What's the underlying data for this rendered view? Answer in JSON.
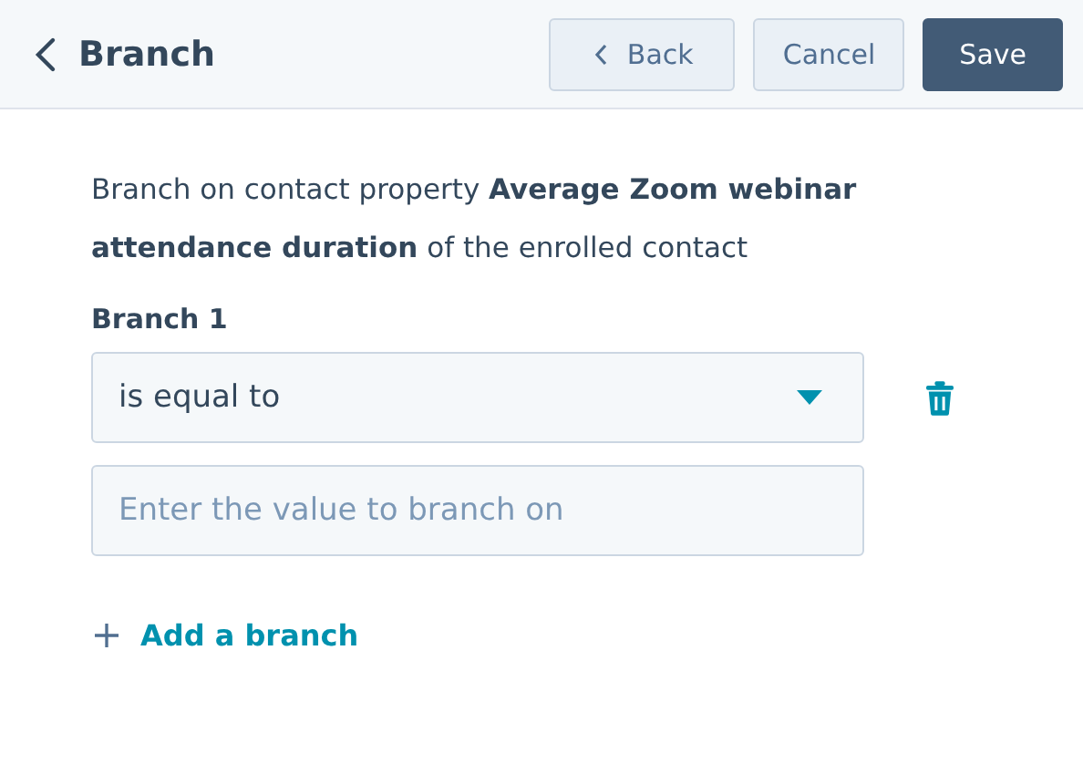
{
  "header": {
    "title": "Branch",
    "buttons": [
      {
        "label": "Back",
        "kind": "back"
      },
      {
        "label": "Cancel",
        "kind": "secondary"
      },
      {
        "label": "Save",
        "kind": "primary"
      }
    ]
  },
  "description": "Branch on contact property **Average Zoom webinar attendance duration** of the enrolled contact",
  "branches": [
    {
      "label": "Branch 1",
      "operator": "is equal to",
      "placeholder": "Enter the value to branch on"
    }
  ],
  "add_branch": "Add a branch"
}
